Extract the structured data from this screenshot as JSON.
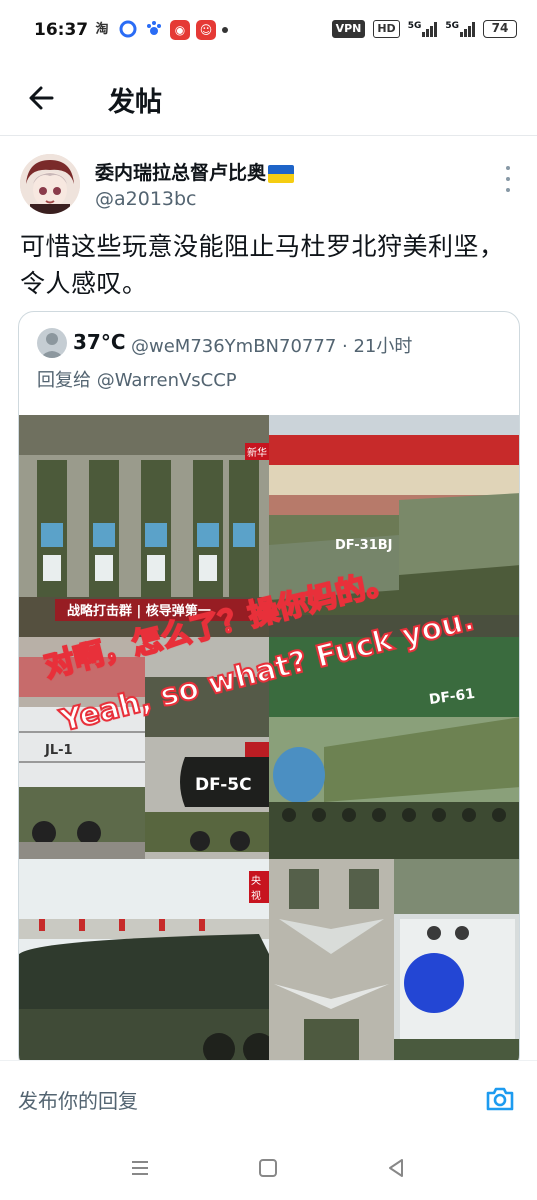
{
  "status_bar": {
    "time": "16:37",
    "vpn": "VPN",
    "hd": "HD",
    "network_1": "5G",
    "network_2": "5G",
    "battery": "74",
    "app_icons": [
      "taobao-icon",
      "circle-app-icon",
      "paw-app-icon",
      "netease-music-icon",
      "red-app-icon"
    ]
  },
  "header": {
    "title": "发帖"
  },
  "tweet": {
    "author_name": "委内瑞拉总督卢比奥",
    "author_handle": "@a2013bc",
    "text": "可惜这些玩意没能阻止马杜罗北狩美利坚，令人感叹。"
  },
  "quoted_tweet": {
    "name": "37°C",
    "handle_meta": "@weM736YmBN70777 · 21小时",
    "reply_prefix": "回复给",
    "reply_handle": "@WarrenVsCCP",
    "media_texts": {
      "overlay_cn": "对啊，怎么了？操你妈的。",
      "overlay_en": "Yeah, so what? Fuck you.",
      "banner_1": "战略打击群 | 核导弹第一",
      "badge_1": "新华",
      "label_df31": "DF-31BJ",
      "label_jl1": "JL-1",
      "label_df5c": "DF-5C",
      "label_df61": "DF-61",
      "badge_2": "央视"
    }
  },
  "reply_bar": {
    "placeholder": "发布你的回复"
  },
  "colors": {
    "text_primary": "#0f1419",
    "text_secondary": "#536471",
    "accent": "#1d9bf0",
    "overlay_red": "#e8303a"
  }
}
